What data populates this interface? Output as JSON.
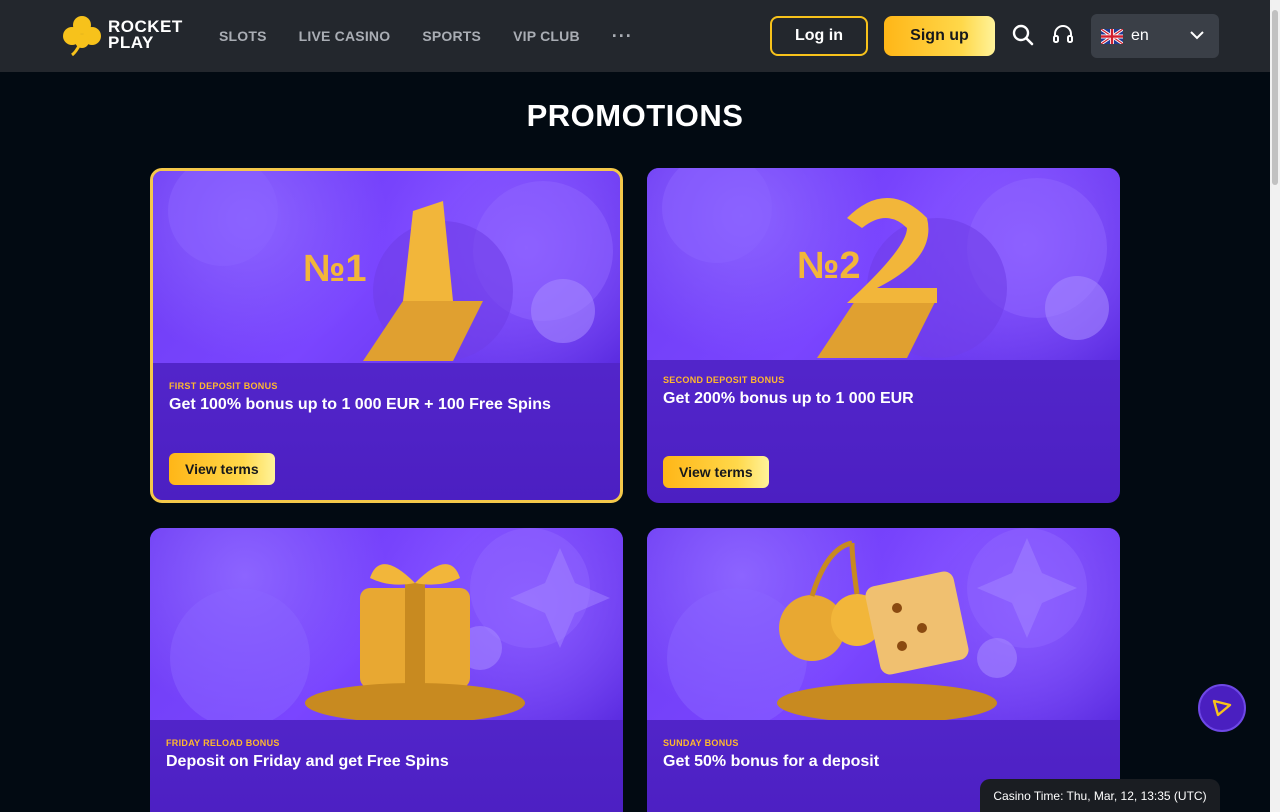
{
  "brand": {
    "line1": "ROCKET",
    "line2": "PLAY"
  },
  "nav": {
    "items": [
      "SLOTS",
      "LIVE CASINO",
      "SPORTS",
      "VIP CLUB"
    ],
    "more": "···"
  },
  "header": {
    "login_label": "Log in",
    "signup_label": "Sign up",
    "language": "en"
  },
  "page": {
    "title": "PROMOTIONS"
  },
  "promotions": [
    {
      "label": "FIRST DEPOSIT BONUS",
      "title": "Get 100% bonus up to 1 000 EUR + 100 Free Spins",
      "button": "View terms",
      "badge": "№1"
    },
    {
      "label": "SECOND DEPOSIT BONUS",
      "title": "Get 200% bonus up to 1 000 EUR",
      "button": "View terms",
      "badge": "№2"
    },
    {
      "label": "FRIDAY RELOAD BONUS",
      "title": "Deposit on Friday and get Free Spins"
    },
    {
      "label": "SUNDAY BONUS",
      "title": "Get 50% bonus for a deposit"
    }
  ],
  "footer": {
    "casino_time": "Casino Time: Thu, Mar, 12, 13:35 (UTC)"
  },
  "colors": {
    "accent": "#f7c21b",
    "card": "#5b2ed6",
    "bg": "#020a12",
    "header": "#23272d"
  }
}
